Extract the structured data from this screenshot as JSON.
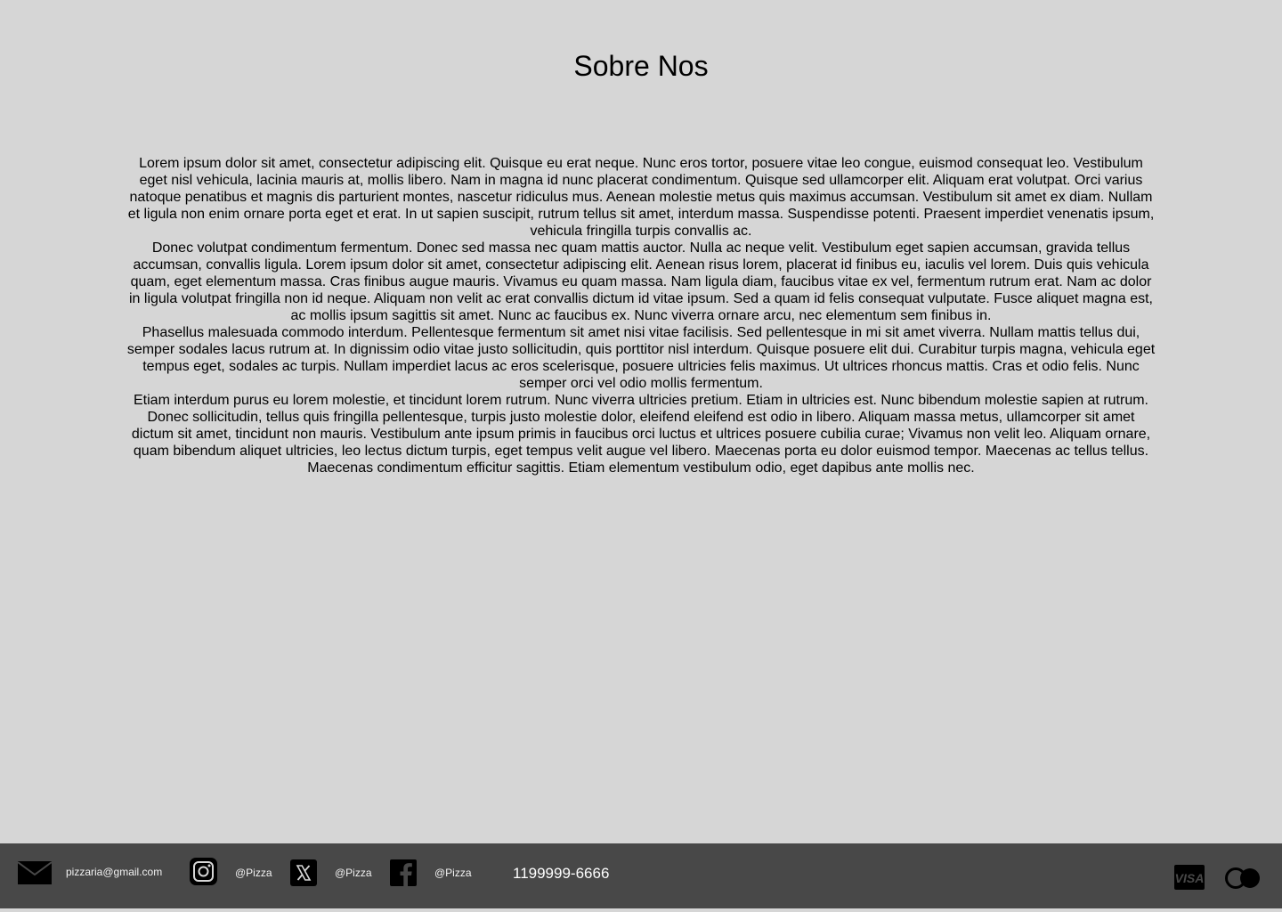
{
  "page": {
    "title": "Sobre Nos"
  },
  "about": {
    "paragraphs": [
      "Lorem ipsum dolor sit amet, consectetur adipiscing elit. Quisque eu erat neque. Nunc eros tortor, posuere vitae leo congue, euismod consequat leo. Vestibulum eget nisl vehicula, lacinia mauris at, mollis libero. Nam in magna id nunc placerat condimentum. Quisque sed ullamcorper elit. Aliquam erat volutpat. Orci varius natoque penatibus et magnis dis parturient montes, nascetur ridiculus mus. Aenean molestie metus quis maximus accumsan. Vestibulum sit amet ex diam. Nullam et ligula non enim ornare porta eget et erat. In ut sapien suscipit, rutrum tellus sit amet, interdum massa. Suspendisse potenti. Praesent imperdiet venenatis ipsum, vehicula fringilla turpis convallis ac.",
      "Donec volutpat condimentum fermentum. Donec sed massa nec quam mattis auctor. Nulla ac neque velit. Vestibulum eget sapien accumsan, gravida tellus accumsan, convallis ligula. Lorem ipsum dolor sit amet, consectetur adipiscing elit. Aenean risus lorem, placerat id finibus eu, iaculis vel lorem. Duis quis vehicula quam, eget elementum massa. Cras finibus augue mauris. Vivamus eu quam massa. Nam ligula diam, faucibus vitae ex vel, fermentum rutrum erat. Nam ac dolor in ligula volutpat fringilla non id neque. Aliquam non velit ac erat convallis dictum id vitae ipsum. Sed a quam id felis consequat vulputate. Fusce aliquet magna est, ac mollis ipsum sagittis sit amet. Nunc ac faucibus ex. Nunc viverra ornare arcu, nec elementum sem finibus in.",
      "Phasellus malesuada commodo interdum. Pellentesque fermentum sit amet nisi vitae facilisis. Sed pellentesque in mi sit amet viverra. Nullam mattis tellus dui, semper sodales lacus rutrum at. In dignissim odio vitae justo sollicitudin, quis porttitor nisl interdum. Quisque posuere elit dui. Curabitur turpis magna, vehicula eget tempus eget, sodales ac turpis. Nullam imperdiet lacus ac eros scelerisque, posuere ultricies felis maximus. Ut ultrices rhoncus mattis. Cras et odio felis. Nunc semper orci vel odio mollis fermentum.",
      "Etiam interdum purus eu lorem molestie, et tincidunt lorem rutrum. Nunc viverra ultricies pretium. Etiam in ultricies est. Nunc bibendum molestie sapien at rutrum. Donec sollicitudin, tellus quis fringilla pellentesque, turpis justo molestie dolor, eleifend eleifend est odio in libero. Aliquam massa metus, ullamcorper sit amet dictum sit amet, tincidunt non mauris. Vestibulum ante ipsum primis in faucibus orci luctus et ultrices posuere cubilia curae; Vivamus non velit leo. Aliquam ornare, quam bibendum aliquet ultricies, leo lectus dictum turpis, eget tempus velit augue vel libero. Maecenas porta eu dolor euismod tempor. Maecenas ac tellus tellus. Maecenas condimentum efficitur sagittis. Etiam elementum vestibulum odio, eget dapibus ante mollis nec."
    ]
  },
  "footer": {
    "email": {
      "icon": "mail-icon",
      "text": "pizzaria@gmail.com"
    },
    "instagram": {
      "icon": "instagram-icon",
      "text": "@Pizza"
    },
    "x": {
      "icon": "x-icon",
      "text": "@Pizza"
    },
    "facebook": {
      "icon": "facebook-icon",
      "text": "@Pizza"
    },
    "phone": "1199999-6666",
    "payments": [
      {
        "icon": "visa-icon",
        "text": "VISA"
      },
      {
        "icon": "mastercard-icon"
      }
    ],
    "colors": {
      "background": "#484848",
      "page_background": "#d6d6d6"
    }
  }
}
